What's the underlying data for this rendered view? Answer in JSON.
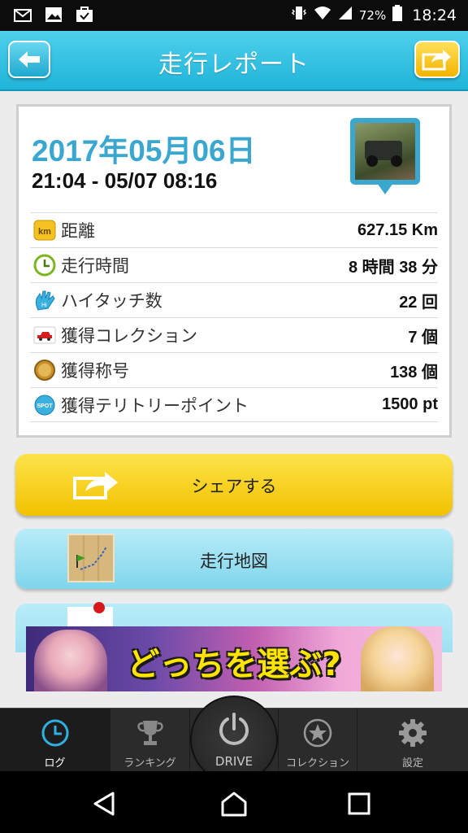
{
  "status_bar": {
    "battery_percent": "72%",
    "time": "18:24"
  },
  "header": {
    "title": "走行レポート"
  },
  "report": {
    "date": "2017年05月06日",
    "time_range": "21:04 - 05/07 08:16",
    "stats": [
      {
        "label": "距離",
        "value": "627.15 Km",
        "icon": "km-icon"
      },
      {
        "label": "走行時間",
        "value": "8 時間 38 分",
        "icon": "clock-icon"
      },
      {
        "label": "ハイタッチ数",
        "value": "22 回",
        "icon": "hi-touch-hand-icon"
      },
      {
        "label": "獲得コレクション",
        "value": "7 個",
        "icon": "car-collection-icon"
      },
      {
        "label": "獲得称号",
        "value": "138 個",
        "icon": "title-medal-icon"
      },
      {
        "label": "獲得テリトリーポイント",
        "value": "1500 pt",
        "icon": "spot-icon"
      }
    ]
  },
  "actions": {
    "share_label": "シェアする",
    "map_label": "走行地図"
  },
  "ad": {
    "text": "どっちを選ぶ?"
  },
  "tabs": [
    {
      "label": "ログ",
      "icon": "clock-icon",
      "active": true
    },
    {
      "label": "ランキング",
      "icon": "trophy-icon",
      "active": false
    },
    {
      "label": "DRIVE",
      "icon": "power-icon",
      "active": false
    },
    {
      "label": "コレクション",
      "icon": "star-icon",
      "active": false
    },
    {
      "label": "設定",
      "icon": "gear-icon",
      "active": false
    }
  ],
  "colors": {
    "header": "#1fb4d9",
    "date_text": "#3aa7cf",
    "share_button": "#f2c200",
    "map_button": "#7fd5ec"
  }
}
